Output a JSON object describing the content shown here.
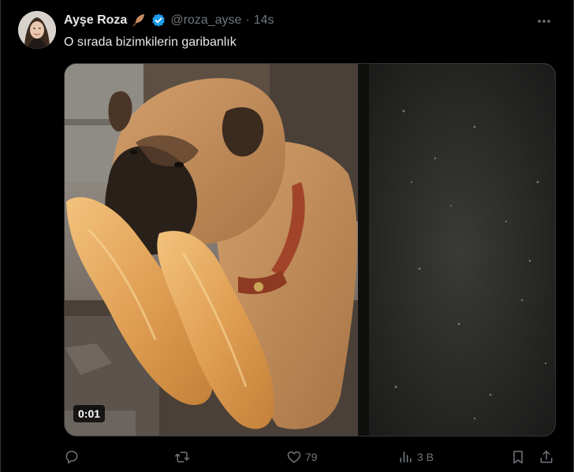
{
  "tweet": {
    "author_name": "Ayşe Roza",
    "name_emoji": "feather-emoji",
    "verified_badge": "verified-icon",
    "handle": "@roza_ayse",
    "separator": "·",
    "time": "14s",
    "text": "O sırada bizimkilerin garibanlık"
  },
  "media": {
    "type": "video",
    "timestamp": "0:01"
  },
  "actions": {
    "reply_count": "",
    "retweet_count": "",
    "like_count": "79",
    "views_count": "3 B"
  },
  "colors": {
    "background": "#000000",
    "text": "#e7e9ea",
    "muted": "#71767b",
    "verified": "#1d9bf0"
  }
}
